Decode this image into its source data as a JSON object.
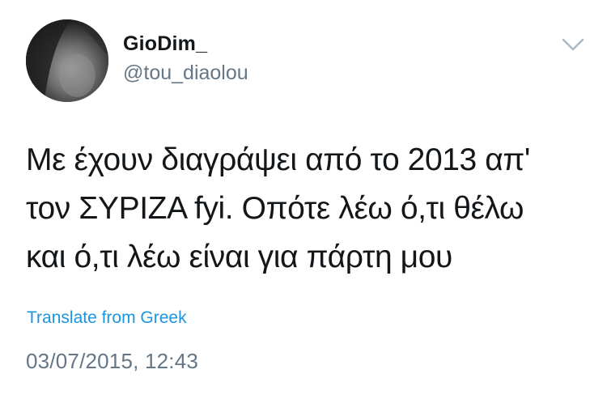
{
  "user": {
    "display_name": "GioDim_",
    "handle": "@tou_diaolou",
    "avatar_icon": "profile-photo"
  },
  "menu": {
    "icon": "chevron-down-icon",
    "color": "#aab8c2"
  },
  "tweet": {
    "lines": [
      "Με έχουν διαγράψει από το 2013 απ'",
      "τον ΣΥΡΙΖΑ fyi. Οπότε λέω ό,τι θέλω",
      "και ό,τι λέω είναι για πάρτη μου"
    ]
  },
  "translate": {
    "label": "Translate from Greek",
    "color": "#1b95e0"
  },
  "meta": {
    "timestamp": "03/07/2015, 12:43"
  }
}
